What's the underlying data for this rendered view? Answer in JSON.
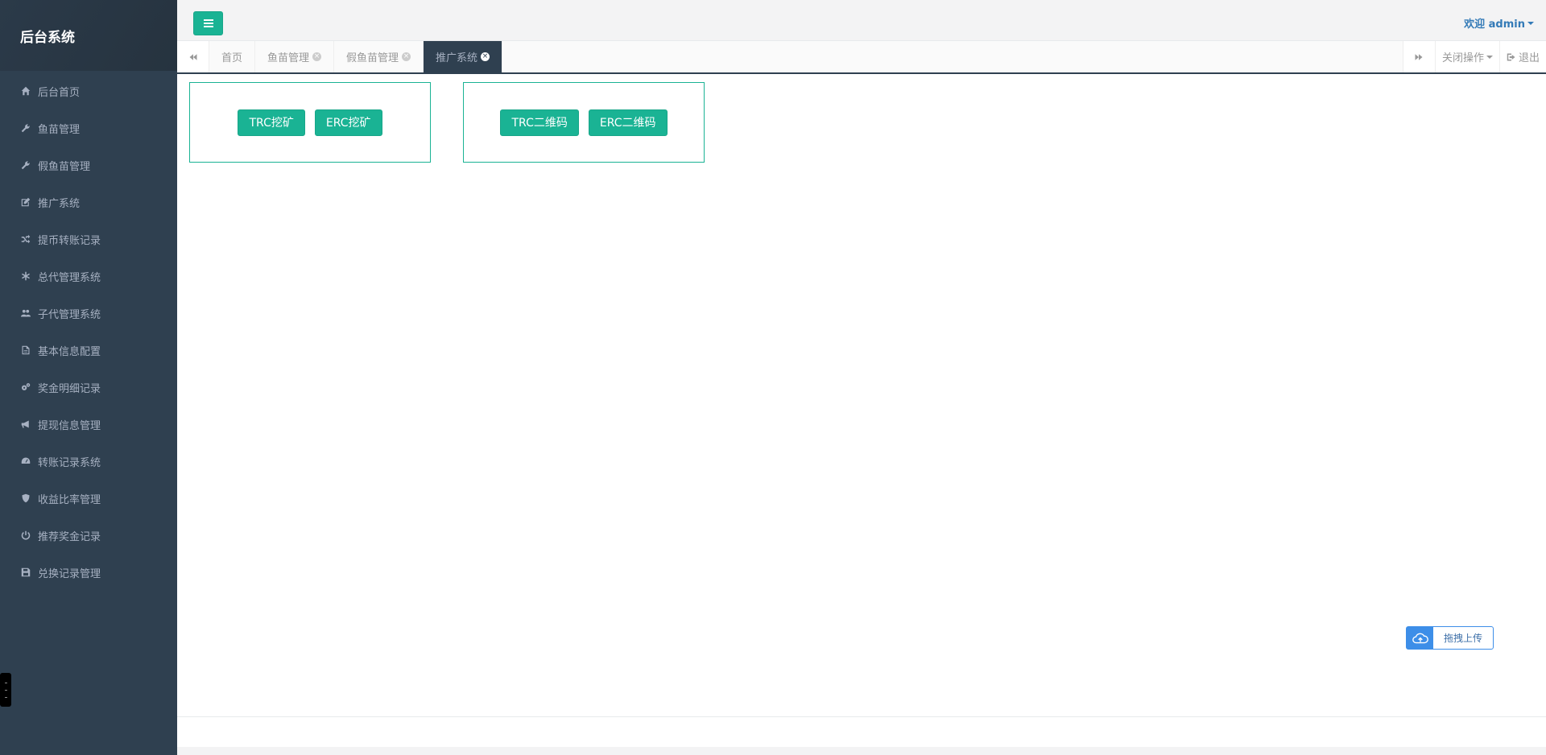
{
  "brand": "后台系统",
  "sidebar": {
    "items": [
      {
        "label": "后台首页",
        "icon": "home-icon"
      },
      {
        "label": "鱼苗管理",
        "icon": "wrench-icon"
      },
      {
        "label": "假鱼苗管理",
        "icon": "wrench-icon"
      },
      {
        "label": "推广系统",
        "icon": "edit-icon"
      },
      {
        "label": "提币转账记录",
        "icon": "shuffle-icon"
      },
      {
        "label": "总代管理系统",
        "icon": "asterisk-icon"
      },
      {
        "label": "子代管理系统",
        "icon": "users-icon"
      },
      {
        "label": "基本信息配置",
        "icon": "file-icon"
      },
      {
        "label": "奖金明细记录",
        "icon": "gears-icon"
      },
      {
        "label": "提现信息管理",
        "icon": "bullhorn-icon"
      },
      {
        "label": "转账记录系统",
        "icon": "dashboard-icon"
      },
      {
        "label": "收益比率管理",
        "icon": "shield-icon"
      },
      {
        "label": "推荐奖金记录",
        "icon": "power-icon"
      },
      {
        "label": "兑换记录管理",
        "icon": "save-icon"
      }
    ]
  },
  "header": {
    "welcome": "欢迎 admin"
  },
  "tabs": [
    {
      "label": "首页",
      "closable": false,
      "active": false
    },
    {
      "label": "鱼苗管理",
      "closable": true,
      "active": false
    },
    {
      "label": "假鱼苗管理",
      "closable": true,
      "active": false
    },
    {
      "label": "推广系统",
      "closable": true,
      "active": true
    }
  ],
  "tab_actions": {
    "close_ops": "关闭操作",
    "logout": "退出"
  },
  "main": {
    "group1": [
      "TRC挖矿",
      "ERC挖矿"
    ],
    "group2": [
      "TRC二维码",
      "ERC二维码"
    ]
  },
  "upload": {
    "label": "拖拽上传"
  },
  "colors": {
    "sidebar_bg": "#2f4050",
    "accent": "#1ab394",
    "link": "#337ab7",
    "upload_blue": "#3d8ee8"
  }
}
